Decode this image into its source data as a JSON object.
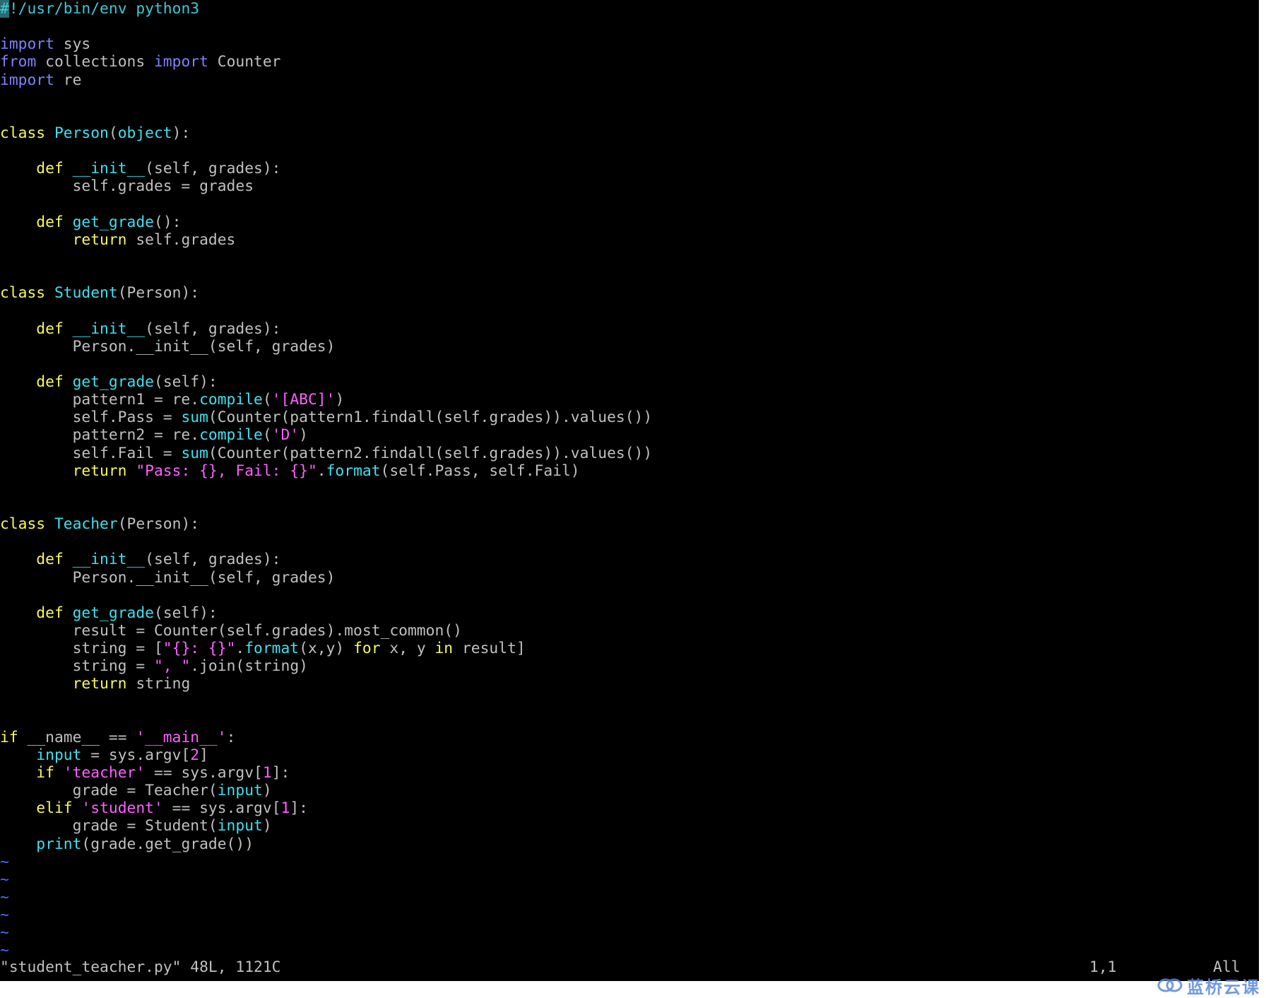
{
  "editor": {
    "code_lines": [
      [
        [
          "cursor",
          "#"
        ],
        [
          "comment",
          "!/usr/bin/env python3"
        ]
      ],
      [],
      [
        [
          "import",
          "import"
        ],
        [
          "plain",
          " sys"
        ]
      ],
      [
        [
          "import",
          "from"
        ],
        [
          "plain",
          " collections "
        ],
        [
          "import",
          "import"
        ],
        [
          "plain",
          " Counter"
        ]
      ],
      [
        [
          "import",
          "import"
        ],
        [
          "plain",
          " re"
        ]
      ],
      [],
      [],
      [
        [
          "keyword",
          "class"
        ],
        [
          "plain",
          " "
        ],
        [
          "builtin",
          "Person"
        ],
        [
          "plain",
          "("
        ],
        [
          "builtin",
          "object"
        ],
        [
          "plain",
          "):"
        ]
      ],
      [],
      [
        [
          "plain",
          "    "
        ],
        [
          "keyword",
          "def"
        ],
        [
          "plain",
          " "
        ],
        [
          "builtin",
          "__init__"
        ],
        [
          "plain",
          "(self, grades):"
        ]
      ],
      [
        [
          "plain",
          "        self.grades = grades"
        ]
      ],
      [],
      [
        [
          "plain",
          "    "
        ],
        [
          "keyword",
          "def"
        ],
        [
          "plain",
          " "
        ],
        [
          "builtin",
          "get_grade"
        ],
        [
          "plain",
          "():"
        ]
      ],
      [
        [
          "plain",
          "        "
        ],
        [
          "keyword",
          "return"
        ],
        [
          "plain",
          " self.grades"
        ]
      ],
      [],
      [],
      [
        [
          "keyword",
          "class"
        ],
        [
          "plain",
          " "
        ],
        [
          "builtin",
          "Student"
        ],
        [
          "plain",
          "(Person):"
        ]
      ],
      [],
      [
        [
          "plain",
          "    "
        ],
        [
          "keyword",
          "def"
        ],
        [
          "plain",
          " "
        ],
        [
          "builtin",
          "__init__"
        ],
        [
          "plain",
          "(self, grades):"
        ]
      ],
      [
        [
          "plain",
          "        Person.__init__(self, grades)"
        ]
      ],
      [],
      [
        [
          "plain",
          "    "
        ],
        [
          "keyword",
          "def"
        ],
        [
          "plain",
          " "
        ],
        [
          "builtin",
          "get_grade"
        ],
        [
          "plain",
          "(self):"
        ]
      ],
      [
        [
          "plain",
          "        pattern1 = re."
        ],
        [
          "builtin",
          "compile"
        ],
        [
          "plain",
          "("
        ],
        [
          "string",
          "'[ABC]'"
        ],
        [
          "plain",
          ")"
        ]
      ],
      [
        [
          "plain",
          "        self.Pass = "
        ],
        [
          "builtin",
          "sum"
        ],
        [
          "plain",
          "(Counter(pattern1.findall(self.grades)).values())"
        ]
      ],
      [
        [
          "plain",
          "        pattern2 = re."
        ],
        [
          "builtin",
          "compile"
        ],
        [
          "plain",
          "("
        ],
        [
          "string",
          "'D'"
        ],
        [
          "plain",
          ")"
        ]
      ],
      [
        [
          "plain",
          "        self.Fail = "
        ],
        [
          "builtin",
          "sum"
        ],
        [
          "plain",
          "(Counter(pattern2.findall(self.grades)).values())"
        ]
      ],
      [
        [
          "plain",
          "        "
        ],
        [
          "keyword",
          "return"
        ],
        [
          "plain",
          " "
        ],
        [
          "string",
          "\"Pass: {}, Fail: {}\""
        ],
        [
          "plain",
          "."
        ],
        [
          "builtin",
          "format"
        ],
        [
          "plain",
          "(self.Pass, self.Fail)"
        ]
      ],
      [],
      [],
      [
        [
          "keyword",
          "class"
        ],
        [
          "plain",
          " "
        ],
        [
          "builtin",
          "Teacher"
        ],
        [
          "plain",
          "(Person):"
        ]
      ],
      [],
      [
        [
          "plain",
          "    "
        ],
        [
          "keyword",
          "def"
        ],
        [
          "plain",
          " "
        ],
        [
          "builtin",
          "__init__"
        ],
        [
          "plain",
          "(self, grades):"
        ]
      ],
      [
        [
          "plain",
          "        Person.__init__(self, grades)"
        ]
      ],
      [],
      [
        [
          "plain",
          "    "
        ],
        [
          "keyword",
          "def"
        ],
        [
          "plain",
          " "
        ],
        [
          "builtin",
          "get_grade"
        ],
        [
          "plain",
          "(self):"
        ]
      ],
      [
        [
          "plain",
          "        result = Counter(self.grades).most_common()"
        ]
      ],
      [
        [
          "plain",
          "        string = ["
        ],
        [
          "string",
          "\"{}: {}\""
        ],
        [
          "plain",
          "."
        ],
        [
          "builtin",
          "format"
        ],
        [
          "plain",
          "(x,y) "
        ],
        [
          "keyword",
          "for"
        ],
        [
          "plain",
          " x, y "
        ],
        [
          "keyword",
          "in"
        ],
        [
          "plain",
          " result]"
        ]
      ],
      [
        [
          "plain",
          "        string = "
        ],
        [
          "string",
          "\", \""
        ],
        [
          "plain",
          ".join(string)"
        ]
      ],
      [
        [
          "plain",
          "        "
        ],
        [
          "keyword",
          "return"
        ],
        [
          "plain",
          " string"
        ]
      ],
      [],
      [],
      [
        [
          "keyword",
          "if"
        ],
        [
          "plain",
          " __name__ == "
        ],
        [
          "string",
          "'__main__'"
        ],
        [
          "plain",
          ":"
        ]
      ],
      [
        [
          "plain",
          "    "
        ],
        [
          "builtin",
          "input"
        ],
        [
          "plain",
          " = sys.argv["
        ],
        [
          "string",
          "2"
        ],
        [
          "plain",
          "]"
        ]
      ],
      [
        [
          "plain",
          "    "
        ],
        [
          "keyword",
          "if"
        ],
        [
          "plain",
          " "
        ],
        [
          "string",
          "'teacher'"
        ],
        [
          "plain",
          " == sys.argv["
        ],
        [
          "string",
          "1"
        ],
        [
          "plain",
          "]:"
        ]
      ],
      [
        [
          "plain",
          "        grade = Teacher("
        ],
        [
          "builtin",
          "input"
        ],
        [
          "plain",
          ")"
        ]
      ],
      [
        [
          "plain",
          "    "
        ],
        [
          "keyword",
          "elif"
        ],
        [
          "plain",
          " "
        ],
        [
          "string",
          "'student'"
        ],
        [
          "plain",
          " == sys.argv["
        ],
        [
          "string",
          "1"
        ],
        [
          "plain",
          "]:"
        ]
      ],
      [
        [
          "plain",
          "        grade = Student("
        ],
        [
          "builtin",
          "input"
        ],
        [
          "plain",
          ")"
        ]
      ],
      [
        [
          "plain",
          "    "
        ],
        [
          "builtin",
          "print"
        ],
        [
          "plain",
          "(grade.get_grade())"
        ]
      ]
    ],
    "tilde_lines": [
      "~",
      "~",
      "~",
      "~",
      "~",
      "~"
    ]
  },
  "status_bar": {
    "file_info": "\"student_teacher.py\" 48L, 1121C",
    "cursor_position": "1,1",
    "scroll_position": "All"
  },
  "watermark": {
    "text": "蓝桥云课"
  },
  "colors": {
    "background": "#000000",
    "plain": "#c0c0c0",
    "keyword": "#f8f860",
    "import": "#8080ff",
    "builtin": "#40e0f0",
    "string": "#ff60ff",
    "comment": "#40c8d8",
    "tilde": "#4a6aff"
  }
}
